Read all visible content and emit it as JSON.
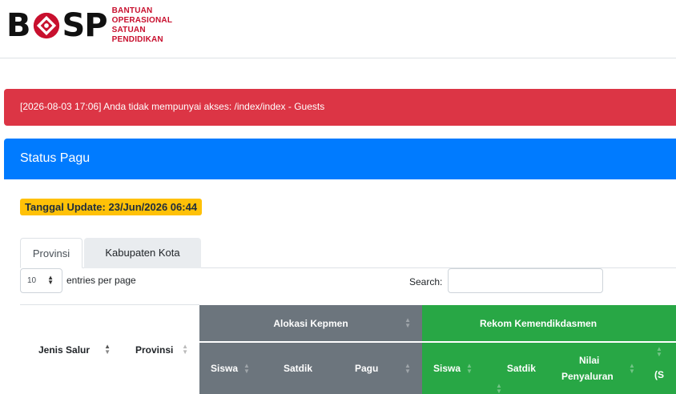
{
  "header": {
    "logo": {
      "letters_left": "B",
      "letters_right": "SP",
      "tagline_lines": [
        "BANTUAN",
        "OPERASIONAL",
        "SATUAN",
        "PENDIDIKAN"
      ]
    }
  },
  "alert": {
    "text": "[2026-08-03 17:06] Anda tidak mempunyai akses: /index/index - Guests",
    "color": "#dc3545"
  },
  "card": {
    "title": "Status Pagu",
    "color": "#007bff"
  },
  "update_badge": {
    "text": "Tanggal Update: 23/Jun/2026 06:44",
    "color": "#ffc107"
  },
  "tabs": [
    {
      "label": "Provinsi",
      "active": true
    },
    {
      "label": "Kabupaten Kota",
      "active": false
    }
  ],
  "table_controls": {
    "page_length": "10",
    "entries_label": "entries per page",
    "search_label": "Search:",
    "search_value": ""
  },
  "table": {
    "columns": {
      "jenis_salur": "Jenis Salur",
      "provinsi": "Provinsi",
      "alokasi_group": "Alokasi Kepmen",
      "rekom_group": "Rekom Kemendikdasmen",
      "siswa": "Siswa",
      "satdik": "Satdik",
      "pagu": "Pagu",
      "nilai_line1": "Nilai",
      "nilai_line2": "Penyaluran",
      "partial": "(S"
    },
    "group_colors": {
      "alokasi": "#6c757d",
      "rekom": "#28a745"
    }
  }
}
